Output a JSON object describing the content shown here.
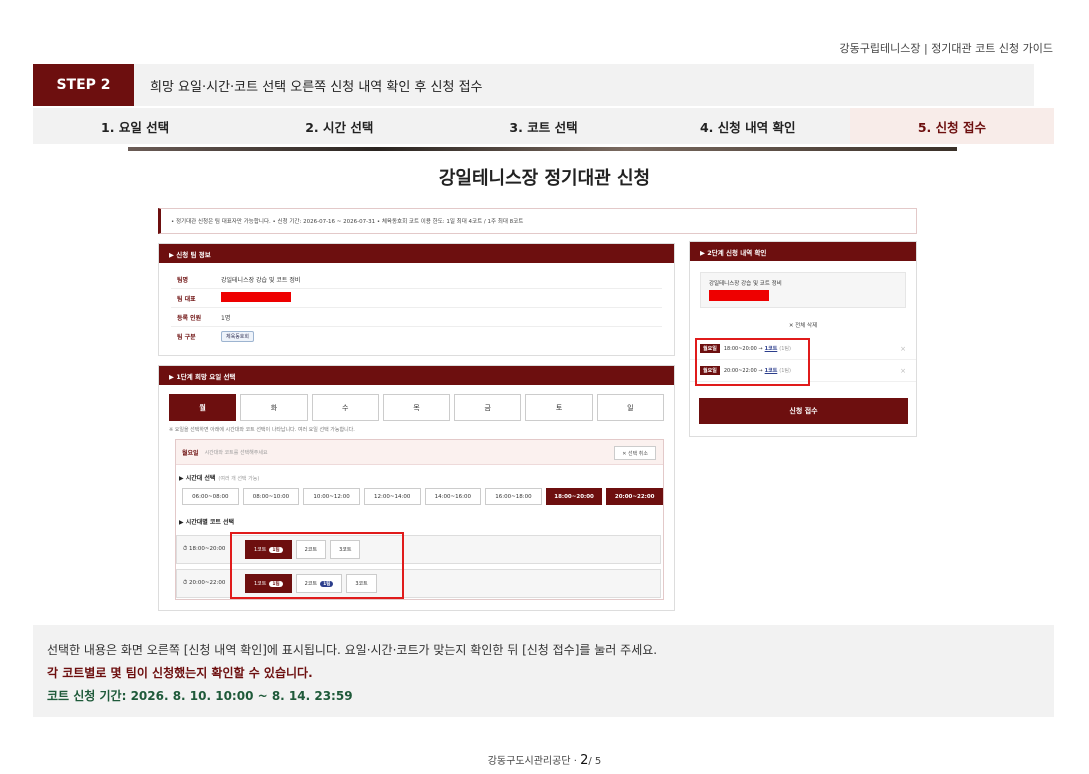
{
  "header": {
    "guide_title": "강동구립테니스장 | 정기대관 코트 신청 가이드"
  },
  "step": {
    "badge": "STEP 2",
    "description": "희망 요일·시간·코트 선택 오른쪽 신청 내역 확인 후 신청 접수"
  },
  "flow": [
    "1. 요일 선택",
    "2. 시간 선택",
    "3. 코트 선택",
    "4. 신청 내역 확인",
    "5. 신청 접수"
  ],
  "screen": {
    "title": "강일테니스장 정기대관 신청",
    "notice": "• 정기대관 신청은 팀 대표자만 가능합니다.   • 신청 기간: 2026-07-16 ~ 2026-07-31   • 체육동호회 코트 이용 한도: 1일 최대 4코트 / 1주 최대 8코트",
    "team_panel": {
      "heading": "▶ 신청 팀 정보",
      "rows": [
        {
          "label": "팀명",
          "value": "강일테니스장 강습 및 코트 정비"
        },
        {
          "label": "팀 대표",
          "value": ""
        },
        {
          "label": "등록 인원",
          "value": "1명"
        },
        {
          "label": "팀 구분",
          "value": "체육동호회"
        }
      ]
    },
    "day_panel": {
      "heading": "▶ 1단계  희망 요일 선택",
      "days": [
        "월",
        "화",
        "수",
        "목",
        "금",
        "토",
        "일"
      ],
      "note": "※ 요일을 선택하면 아래에 시간대와 코트 선택이 나타납니다. 여러 요일 선택 가능합니다.",
      "selected_day": "월요일",
      "selected_hint": "시간대와 코트를 선택해주세요",
      "cancel": "✕ 선택 취소",
      "time_label": "▶ 시간대 선택",
      "time_hint": "(여러 개 선택 가능)",
      "times": [
        "06:00~08:00",
        "08:00~10:00",
        "10:00~12:00",
        "12:00~14:00",
        "14:00~16:00",
        "16:00~18:00",
        "18:00~20:00",
        "20:00~22:00"
      ],
      "court_label": "▶ 시간대별 코트 선택",
      "court_rows": [
        {
          "time": "⏱ 18:00~20:00",
          "c1": "1코트",
          "c1n": "1팀",
          "c2": "2코트",
          "c3": "3코트"
        },
        {
          "time": "⏱ 20:00~22:00",
          "c1": "1코트",
          "c1n": "1팀",
          "c2": "2코트",
          "c2n": "1팀",
          "c3": "3코트"
        }
      ]
    },
    "confirm_panel": {
      "heading": "▶ 2단계  신청 내역 확인",
      "team": "강일테니스장 강습 및 코트 정비",
      "clear_all": "✕ 전체 삭제",
      "items": [
        {
          "day": "월요일",
          "time": "18:00~20:00 →",
          "court": "1코트",
          "count": "(1팀)"
        },
        {
          "day": "월요일",
          "time": "20:00~22:00 →",
          "court": "1코트",
          "count": "(1팀)"
        }
      ],
      "submit": "신청 접수"
    }
  },
  "bottom": {
    "line1": "선택한 내용은 화면 오른쪽 [신청 내역 확인]에 표시됩니다.  요일·시간·코트가 맞는지 확인한 뒤 [신청 접수]를 눌러 주세요.",
    "line2": "각 코트별로 몇 팀이 신청했는지 확인할 수 있습니다.",
    "line3": "코트 신청 기간: 2026. 8. 10. 10:00 ~ 8. 14. 23:59"
  },
  "footer": {
    "org": "강동구도시관리공단  ·",
    "page": "2",
    "total": "/ 5"
  },
  "colors": {
    "accent": "#6d0f0f",
    "highlight": "#e01b1b",
    "period": "#1f5a3a"
  }
}
